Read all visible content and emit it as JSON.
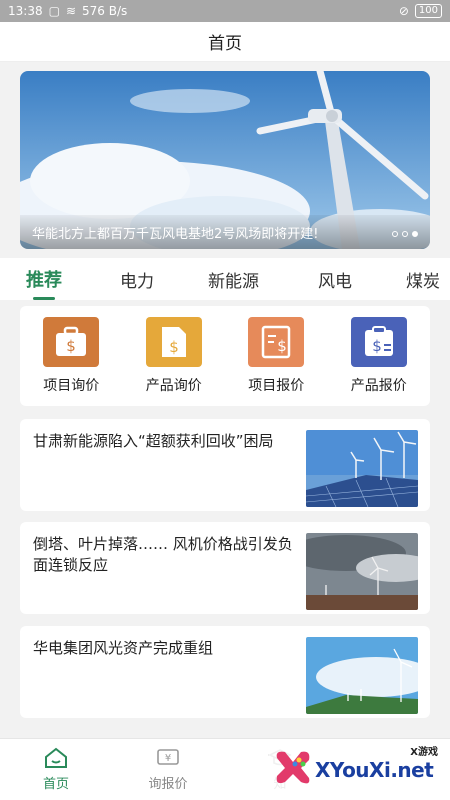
{
  "status": {
    "time": "13:38",
    "speed": "576 B/s",
    "battery": "100"
  },
  "title": "首页",
  "banner": {
    "caption": "华能北方上都百万千瓦风电基地2号风场即将开建!"
  },
  "tabs": [
    "推荐",
    "电力",
    "新能源",
    "风电",
    "煤炭"
  ],
  "quick": [
    {
      "label": "项目询价",
      "icon": "briefcase-dollar-icon",
      "color": "#d07a3a"
    },
    {
      "label": "产品询价",
      "icon": "document-dollar-icon",
      "color": "#e5a83a"
    },
    {
      "label": "项目报价",
      "icon": "list-dollar-icon",
      "color": "#e68a5a"
    },
    {
      "label": "产品报价",
      "icon": "clipboard-dollar-icon",
      "color": "#4a62b8"
    }
  ],
  "news": [
    {
      "title": "甘肃新能源陷入“超额获利回收”困局"
    },
    {
      "title": "倒塔、叶片掉落…… 风机价格战引发负面连锁反应"
    },
    {
      "title": "华电集团风光资产完成重组"
    }
  ],
  "nav": [
    "首页",
    "询报价",
    "知"
  ],
  "watermark": {
    "small": "X游戏",
    "big": "XYouXi.net"
  },
  "colors": {
    "accent": "#2a8a5a"
  }
}
